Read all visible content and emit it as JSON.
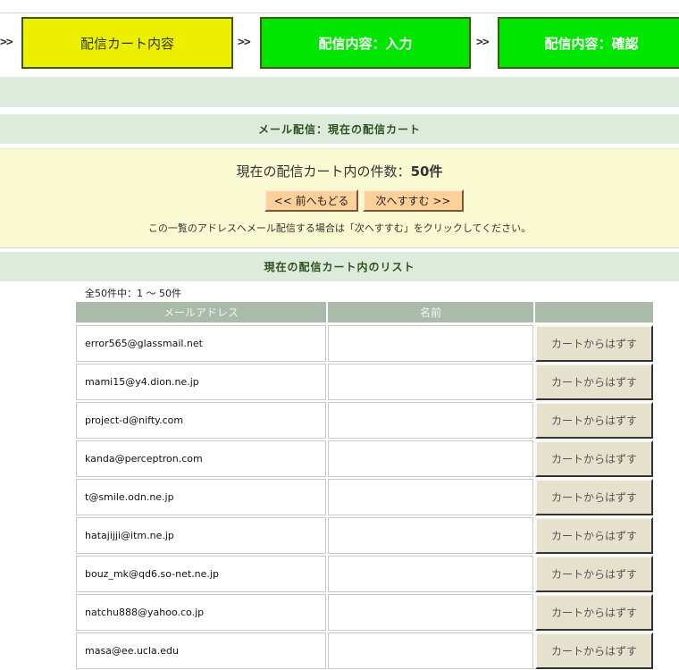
{
  "steps": {
    "sep": ">>",
    "items": [
      {
        "label": "配信カート内容"
      },
      {
        "label": "配信内容：入力"
      },
      {
        "label": "配信内容：確認"
      }
    ]
  },
  "section1_title": "メール配信：現在の配信カート",
  "info": {
    "count_label": "現在の配信カート内の件数：",
    "count_value": "50件",
    "back_button": "<< 前へもどる",
    "next_button": "次へすすむ >>",
    "note": "この一覧のアドレスへメール配信する場合は「次へすすむ」をクリックしてください。"
  },
  "section2_title": "現在の配信カート内のリスト",
  "range_text": "全50件中：1 〜 50件",
  "table": {
    "headers": {
      "email": "メールアドレス",
      "name": "名前",
      "action": ""
    },
    "remove_label": "カートからはずす",
    "rows": [
      {
        "email": "error565@glassmail.net",
        "name": ""
      },
      {
        "email": "mami15@y4.dion.ne.jp",
        "name": ""
      },
      {
        "email": "project-d@nifty.com",
        "name": ""
      },
      {
        "email": "kanda@perceptron.com",
        "name": ""
      },
      {
        "email": "t@smile.odn.ne.jp",
        "name": ""
      },
      {
        "email": "hatajijji@itm.ne.jp",
        "name": ""
      },
      {
        "email": "bouz_mk@qd6.so-net.ne.jp",
        "name": ""
      },
      {
        "email": "natchu888@yahoo.co.jp",
        "name": ""
      },
      {
        "email": "masa@ee.ucla.edu",
        "name": ""
      }
    ]
  },
  "colors": {
    "step_active": "#eeee00",
    "step_inactive": "#00e600",
    "band": "#dcebdc",
    "info_bg": "#fafad2",
    "nav_button": "#ffd09a",
    "table_header": "#aabbaa",
    "remove_button": "#e6e1cc"
  }
}
